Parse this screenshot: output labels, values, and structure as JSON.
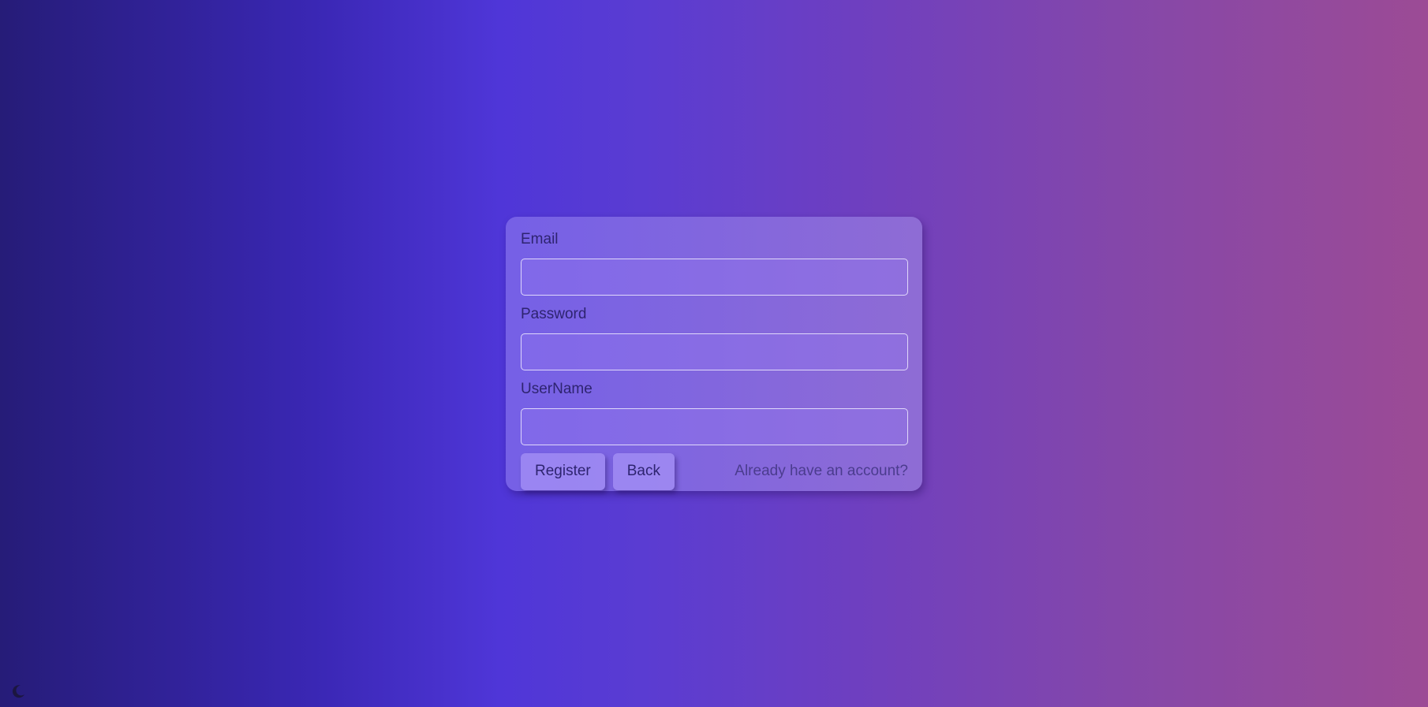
{
  "register_form": {
    "email": {
      "label": "Email",
      "value": "",
      "placeholder": ""
    },
    "password": {
      "label": "Password",
      "value": "",
      "placeholder": ""
    },
    "username": {
      "label": "UserName",
      "value": "",
      "placeholder": ""
    },
    "register_label": "Register",
    "back_label": "Back",
    "login_link_label": "Already have an account?"
  },
  "theme_toggle": {
    "icon": "moon-icon"
  },
  "colors": {
    "gradient_start": "#261c78",
    "gradient_mid": "#4f36d8",
    "gradient_end": "#9c4b95",
    "label_text": "#2e2470",
    "link_text": "#4b3c8e"
  }
}
